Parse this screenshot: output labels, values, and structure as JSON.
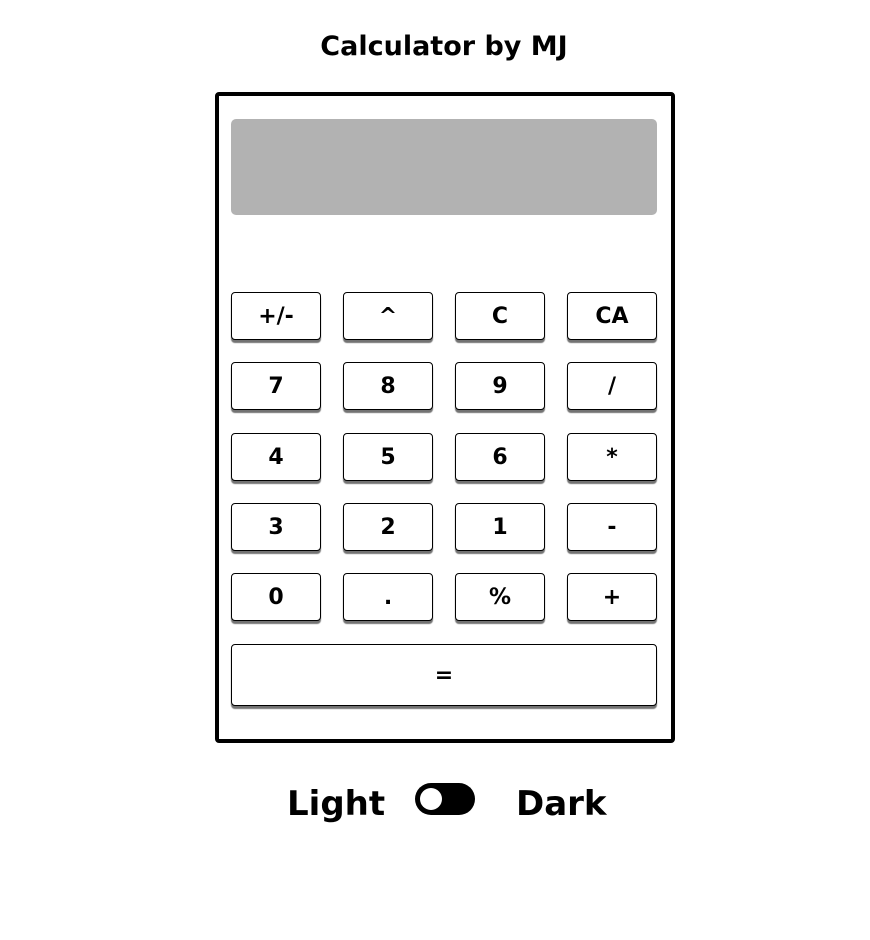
{
  "page": {
    "title": "Calculator by MJ"
  },
  "display": {
    "value": ""
  },
  "keys": {
    "row1": [
      "+/-",
      "^",
      "C",
      "CA"
    ],
    "row2": [
      "7",
      "8",
      "9",
      "/"
    ],
    "row3": [
      "4",
      "5",
      "6",
      "*"
    ],
    "row4": [
      "3",
      "2",
      "1",
      "-"
    ],
    "row5": [
      "0",
      ".",
      "%",
      "+"
    ],
    "equals": "="
  },
  "theme": {
    "light_label": "Light",
    "dark_label": "Dark",
    "mode": "light"
  },
  "colors": {
    "display_bg": "#b2b2b2",
    "border": "#000000",
    "background": "#ffffff"
  }
}
